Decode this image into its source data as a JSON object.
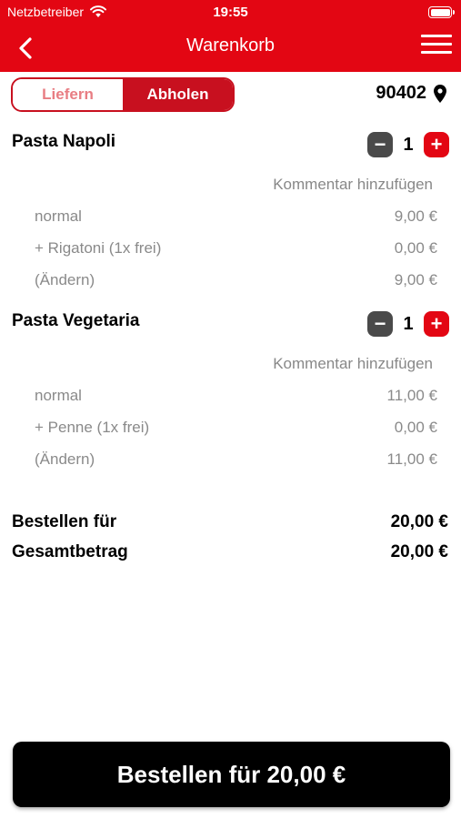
{
  "status_bar": {
    "carrier": "Netzbetreiber",
    "time": "19:55"
  },
  "nav": {
    "title": "Warenkorb"
  },
  "delivery_toggle": {
    "options": [
      "Liefern",
      "Abholen"
    ],
    "selected": "Abholen"
  },
  "location": {
    "postcode": "90402"
  },
  "cart": {
    "items": [
      {
        "name": "Pasta Napoli",
        "quantity": "1",
        "minus": "−",
        "plus": "+",
        "comment_label": "Kommentar hinzufügen",
        "lines": [
          {
            "label": "normal",
            "price": "9,00 €"
          },
          {
            "label": "+ Rigatoni (1x frei)",
            "price": "0,00 €"
          },
          {
            "label": "(Ändern)",
            "price": "9,00 €"
          }
        ]
      },
      {
        "name": "Pasta Vegetaria",
        "quantity": "1",
        "minus": "−",
        "plus": "+",
        "comment_label": "Kommentar hinzufügen",
        "lines": [
          {
            "label": "normal",
            "price": "11,00 €"
          },
          {
            "label": "+ Penne (1x frei)",
            "price": "0,00 €"
          },
          {
            "label": "(Ändern)",
            "price": "11,00 €"
          }
        ]
      }
    ]
  },
  "summary": {
    "order_for_label": "Bestellen für",
    "order_for_value": "20,00 €",
    "total_label": "Gesamtbetrag",
    "total_value": "20,00 €"
  },
  "order_button": {
    "label": "Bestellen für 20,00 €"
  },
  "colors": {
    "brand_red": "#e30613",
    "toggle_red": "#c8101f",
    "button_black": "#000000",
    "muted_text": "#8a8a8a"
  }
}
